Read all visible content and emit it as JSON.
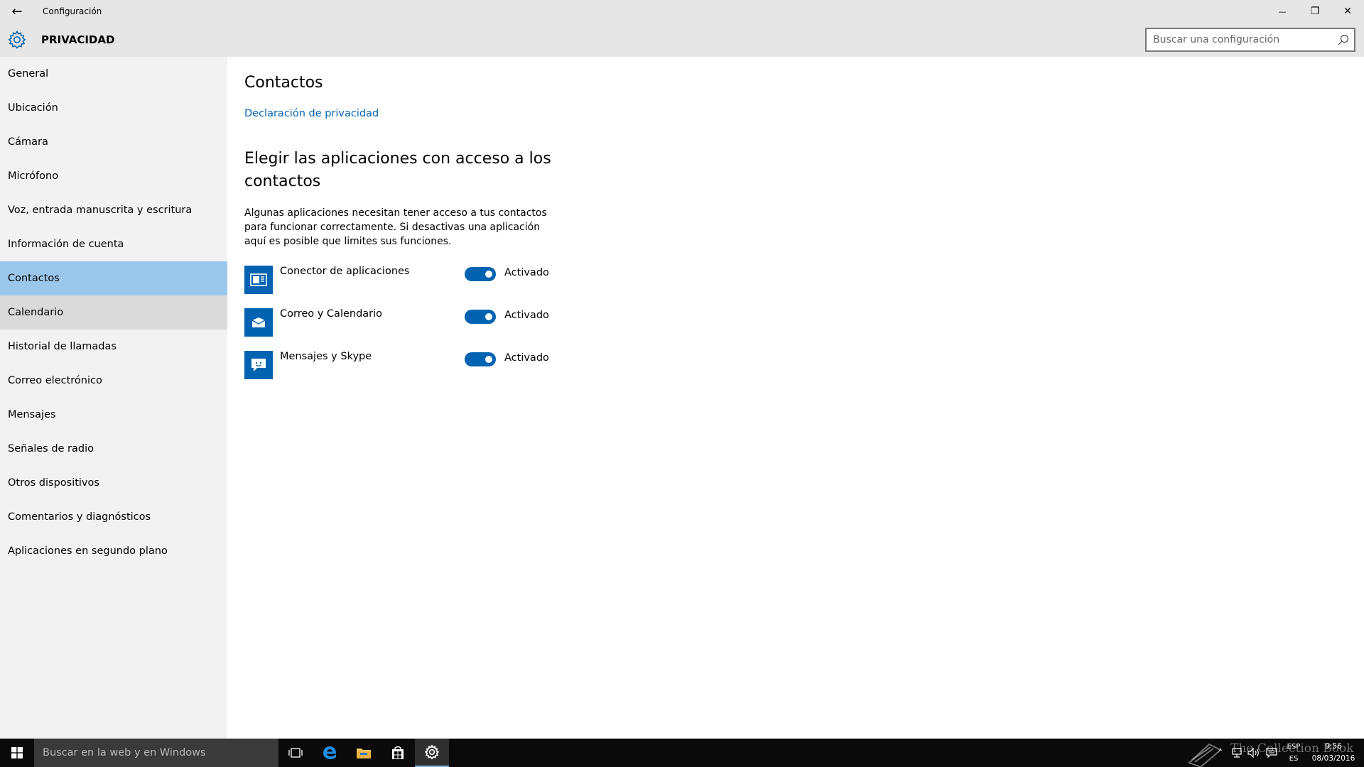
{
  "window": {
    "title": "Configuración",
    "back_icon": "←",
    "minimize_icon": "—",
    "maximize_icon": "❐",
    "close_icon": "✕"
  },
  "header": {
    "title": "PRIVACIDAD",
    "search_placeholder": "Buscar una configuración",
    "search_value": ""
  },
  "sidebar": {
    "selected": "Contactos",
    "items": [
      {
        "label": "General"
      },
      {
        "label": "Ubicación"
      },
      {
        "label": "Cámara"
      },
      {
        "label": "Micrófono"
      },
      {
        "label": "Voz, entrada manuscrita y escritura"
      },
      {
        "label": "Información de cuenta"
      },
      {
        "label": "Contactos"
      },
      {
        "label": "Calendario"
      },
      {
        "label": "Historial de llamadas"
      },
      {
        "label": "Correo electrónico"
      },
      {
        "label": "Mensajes"
      },
      {
        "label": "Señales de radio"
      },
      {
        "label": "Otros dispositivos"
      },
      {
        "label": "Comentarios y diagnósticos"
      },
      {
        "label": "Aplicaciones en segundo plano"
      }
    ]
  },
  "main": {
    "title": "Contactos",
    "privacy_link": "Declaración de privacidad",
    "section_title": "Elegir las aplicaciones con acceso a los contactos",
    "description": "Algunas aplicaciones necesitan tener acceso a tus contactos para funcionar correctamente. Si desactivas una aplicación aquí es posible que limites sus funciones.",
    "apps": [
      {
        "name": "Conector de aplicaciones",
        "icon": "app-connector-icon",
        "state": "Activado",
        "on": true
      },
      {
        "name": "Correo y Calendario",
        "icon": "mail-icon",
        "state": "Activado",
        "on": true
      },
      {
        "name": "Mensajes y Skype",
        "icon": "messaging-icon",
        "state": "Activado",
        "on": true
      }
    ]
  },
  "taskbar": {
    "search_placeholder": "Buscar en la web y en Windows",
    "language": "ESP",
    "language_sub": "ES",
    "time": "9:56",
    "date": "08/03/2016",
    "watermark": "The Collection Book"
  },
  "colors": {
    "accent": "#0063b1",
    "selected_nav": "#9cc7ec",
    "hover_nav": "#dadada",
    "chrome": "#e6e6e6",
    "sidebar": "#f2f2f2",
    "taskbar": "#0a0a0a"
  }
}
